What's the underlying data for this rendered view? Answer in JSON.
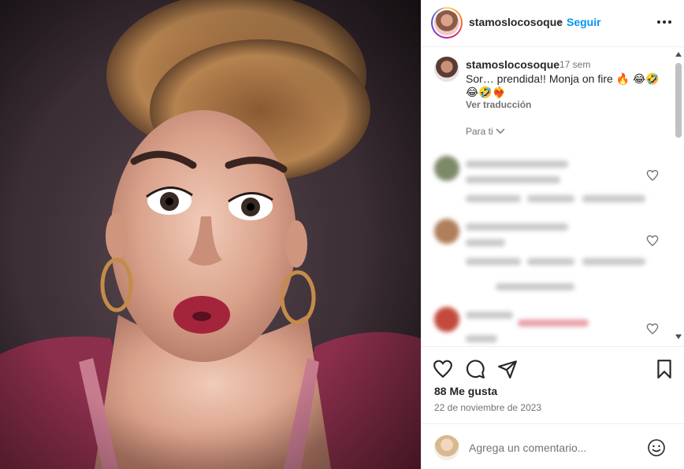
{
  "header": {
    "username": "stamoslocosoque",
    "separator": "•",
    "follow_label": "Seguir"
  },
  "caption": {
    "username": "stamoslocosoque",
    "time": "17 sem",
    "text": "Sor… prendida!! Monja on fire 🔥 😂🤣 😂🤣❤️‍🔥",
    "translate_label": "Ver traducción",
    "for_you_label": "Para ti"
  },
  "post": {
    "likes": "88 Me gusta",
    "date": "22 de noviembre de 2023"
  },
  "comment_box": {
    "placeholder": "Agrega un comentario..."
  },
  "colors": {
    "follow": "#0095f6",
    "muted": "#737373",
    "text": "#262626"
  },
  "icons": [
    "more-options-icon",
    "heart-icon",
    "comment-icon",
    "share-icon",
    "save-icon",
    "emoji-icon",
    "chevron-down-icon"
  ]
}
